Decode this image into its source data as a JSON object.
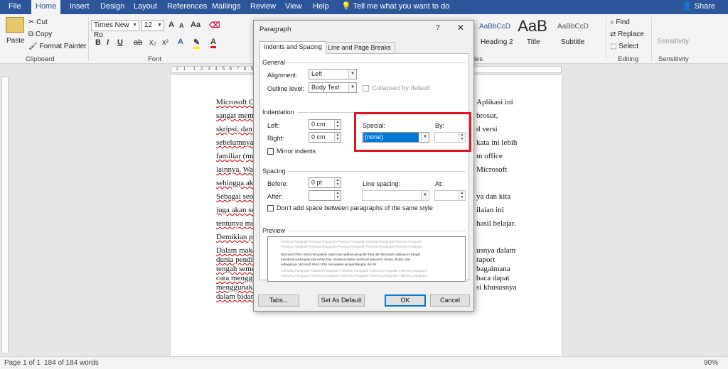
{
  "ribbon_tabs": [
    "File",
    "Home",
    "Insert",
    "Design",
    "Layout",
    "References",
    "Mailings",
    "Review",
    "View",
    "Help"
  ],
  "tell_me": "Tell me what you want to do",
  "share": "Share",
  "clipboard": {
    "paste": "Paste",
    "cut": "Cut",
    "copy": "Copy",
    "format_painter": "Format Painter",
    "label": "Clipboard"
  },
  "font": {
    "name": "Times New Ro",
    "size": "12",
    "label": "Font",
    "grow": "A",
    "shrink": "A",
    "aa": "Aa"
  },
  "styles": {
    "heading2_preview": "AaBbCcD",
    "heading2": "Heading 2",
    "title_preview": "AaB",
    "title": "Title",
    "subtitle_preview": "AaBbCcD",
    "subtitle": "Subtitle",
    "label_tail": "les"
  },
  "editing": {
    "find": "Find",
    "replace": "Replace",
    "select": "Select",
    "label": "Editing"
  },
  "sensitivity": {
    "button": "Sensitivity",
    "label": "Sensitivity"
  },
  "ruler_marks": "· 2 · 1 · · 1 · 2 · 3 · 4 · 5 · 6 · 7 · 8 · 9 · 10 · 11 · 12 · 13 · 14 · · 16 · 17 · 18 · 19",
  "document": {
    "left_lines": [
      "Microsoft O",
      "sangat mem",
      "skripsi, dan",
      "sebelumnya",
      "familiar (mu",
      "lainnya. Wa",
      "sehingga akl",
      "Sebagai seor",
      "juga akan se",
      "tentunya me",
      "Demikian pu",
      "Dalam maka",
      "dunia pendic",
      "tengah seme",
      "cara menggu",
      "menggunaka",
      "dalam bidan"
    ],
    "right_lines": [
      "Aplikasi ini",
      "brosur,",
      "d versi",
      "kata ini lebih",
      "m office",
      "Microsoft",
      "",
      "ya dan kita",
      "ilaian ini",
      "hasil belajar.",
      "",
      "usnya dalam",
      "raport",
      "bagaimana",
      "baca dapat",
      "si khususnya",
      ""
    ]
  },
  "status": {
    "page": "Page 1 of 1",
    "words": "184 of 184 words",
    "zoom": "90%"
  },
  "dialog": {
    "title": "Paragraph",
    "help": "?",
    "close": "✕",
    "tabs": [
      "Indents and Spacing",
      "Line and Page Breaks"
    ],
    "general": {
      "heading": "General",
      "alignment_label": "Alignment:",
      "alignment_value": "Left",
      "outline_label": "Outline level:",
      "outline_value": "Body Text",
      "collapsed": "Collapsed by default"
    },
    "indentation": {
      "heading": "Indentation",
      "left_label": "Left:",
      "left_value": "0 cm",
      "right_label": "Right:",
      "right_value": "0 cm",
      "special_label": "Special:",
      "special_value": "(none)",
      "by_label": "By:",
      "mirror": "Mirror indents"
    },
    "spacing": {
      "heading": "Spacing",
      "before_label": "Before:",
      "before_value": "0 pt",
      "after_label": "After:",
      "line_label": "Line spacing:",
      "at_label": "At:",
      "no_space": "Don't add space between paragraphs of the same style"
    },
    "preview": {
      "heading": "Preview",
      "prev": "Previous Paragraph Previous Paragraph Previous Paragraph Previous Paragraph Previous Paragraph",
      "body1": "Microsoft Office Word merupakan salah satu aplikasi pengolah kata dari Microsoft. Aplikasi ini sangat",
      "body2": "membantu pekerjaan kita sehari-hari, misalnya dalam membuat dokumen, brosur, skripsi, dan",
      "body3": "sebagainya. Microsoft Word 2016 merupakan pengembangan dari W",
      "next": "Following Paragraph Following Paragraph Following Paragraph Following Paragraph Following Paragraph"
    },
    "buttons": {
      "tabs": "Tabs...",
      "default": "Set As Default",
      "ok": "OK",
      "cancel": "Cancel"
    }
  },
  "colors": {
    "accent": "#2b579a",
    "highlight_box": "#e0141f",
    "selection": "#0078d7"
  }
}
